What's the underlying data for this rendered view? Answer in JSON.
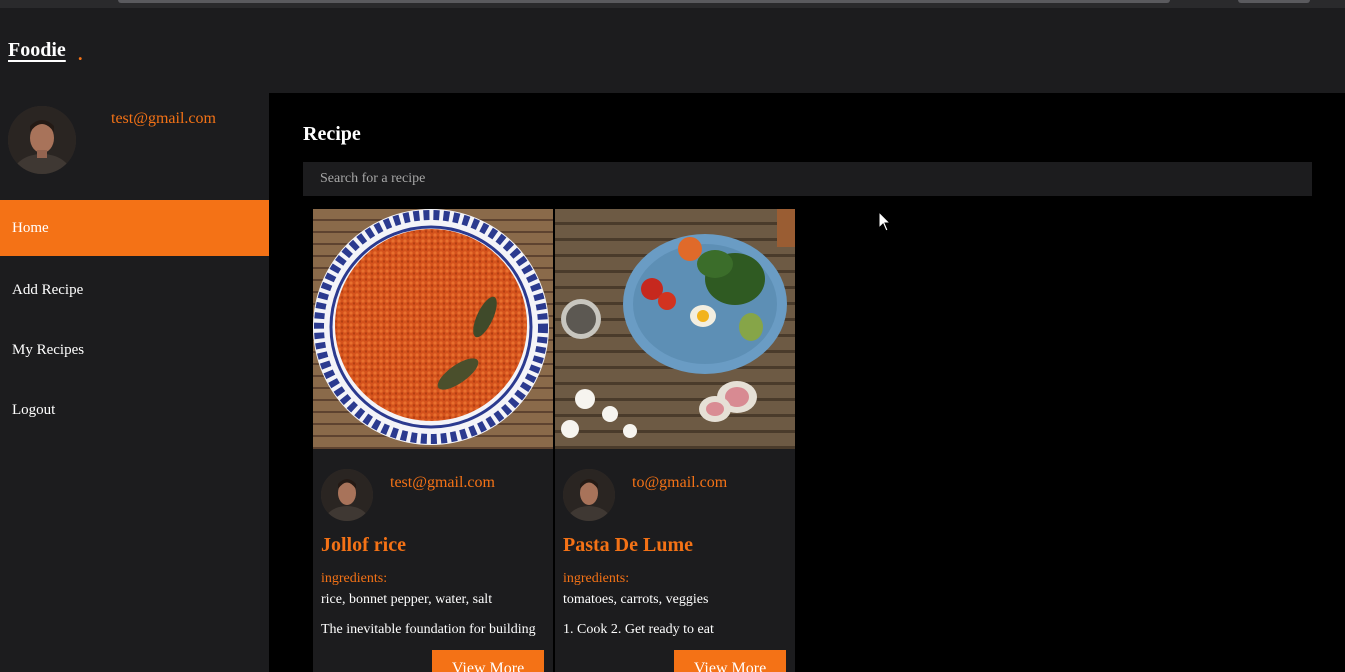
{
  "app": {
    "logo": "Foodie",
    "logo_dot": "."
  },
  "sidebar": {
    "user_email": "test@gmail.com",
    "nav": [
      {
        "label": "Home",
        "active": true
      },
      {
        "label": "Add Recipe",
        "active": false
      },
      {
        "label": "My Recipes",
        "active": false
      },
      {
        "label": "Logout",
        "active": false
      }
    ]
  },
  "main": {
    "title": "Recipe",
    "search_placeholder": "Search for a recipe",
    "recipes": [
      {
        "author": "test@gmail.com",
        "title": "Jollof rice",
        "ingredients_label": "ingredients:",
        "ingredients": "rice, bonnet pepper, water, salt",
        "description": "The inevitable foundation for building",
        "button": "View More"
      },
      {
        "author": "to@gmail.com",
        "title": "Pasta De Lume",
        "ingredients_label": "ingredients:",
        "ingredients": "tomatoes, carrots, veggies",
        "description": "1. Cook 2. Get ready to eat",
        "button": "View More"
      }
    ]
  },
  "colors": {
    "accent": "#f47216",
    "panel": "#1c1c1e",
    "main_bg": "#000000"
  }
}
